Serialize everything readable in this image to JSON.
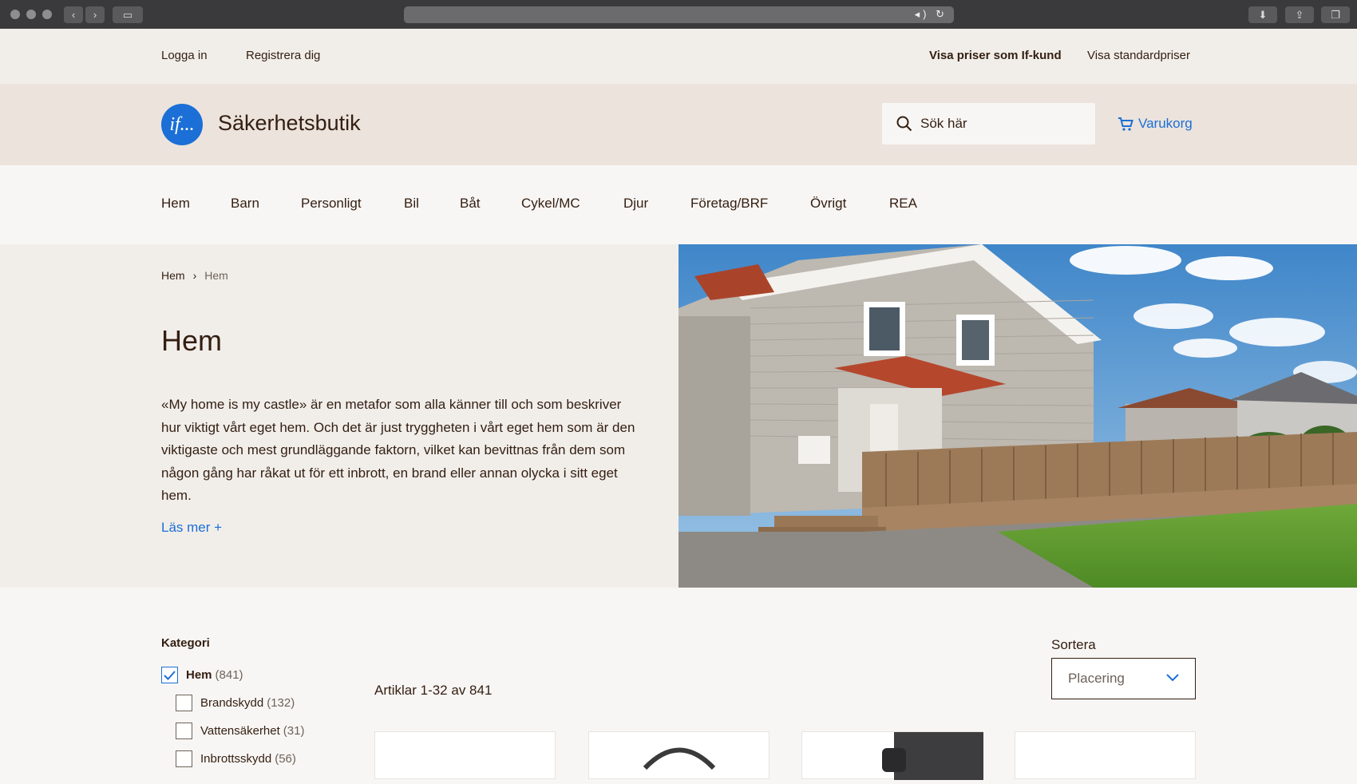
{
  "utility": {
    "login": "Logga in",
    "register": "Registrera dig",
    "if_prices": "Visa priser som If-kund",
    "standard_prices": "Visa standardpriser"
  },
  "header": {
    "logo_text": "if...",
    "brand": "Säkerhetsbutik",
    "search_placeholder": "Sök här",
    "cart": "Varukorg"
  },
  "nav": [
    "Hem",
    "Barn",
    "Personligt",
    "Bil",
    "Båt",
    "Cykel/MC",
    "Djur",
    "Företag/BRF",
    "Övrigt",
    "REA"
  ],
  "breadcrumb": [
    "Hem",
    "Hem"
  ],
  "hero": {
    "title": "Hem",
    "text": "«My home is my castle» är en metafor som alla känner till och som beskriver hur viktigt vårt eget hem. Och det är just tryggheten i vårt eget hem som är den viktigaste och mest grundläggande faktorn, vilket kan bevittnas från dem som någon gång har råkat ut för ett inbrott, en brand eller annan olycka i sitt eget hem.",
    "read_more": "Läs mer +"
  },
  "filters": {
    "title": "Kategori",
    "items": [
      {
        "label": "Hem",
        "count": "(841)",
        "checked": true
      },
      {
        "label": "Brandskydd",
        "count": "(132)",
        "checked": false
      },
      {
        "label": "Vattensäkerhet",
        "count": "(31)",
        "checked": false
      },
      {
        "label": "Inbrottsskydd",
        "count": "(56)",
        "checked": false
      }
    ]
  },
  "listing": {
    "articles": "Artiklar 1-32 av 841",
    "sort_label": "Sortera",
    "sort_value": "Placering"
  },
  "colors": {
    "accent": "#1b6fd6",
    "text": "#331e11",
    "header_bg": "#ebe3dc"
  }
}
